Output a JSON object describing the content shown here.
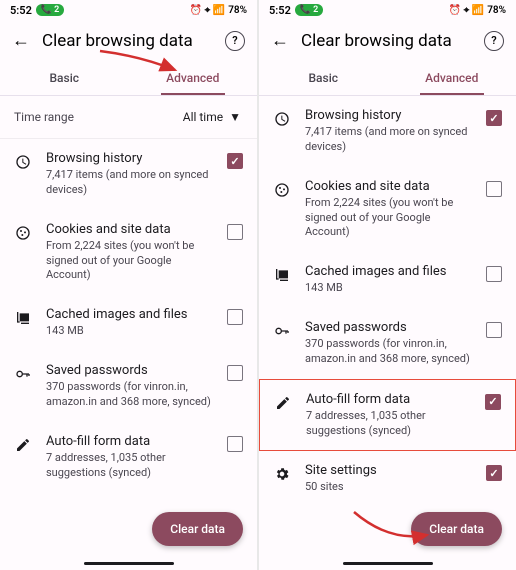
{
  "status": {
    "time": "5:52",
    "notif_count": "2",
    "battery": "78%",
    "icons": "⏰ ⌖ 📶"
  },
  "header": {
    "title": "Clear browsing data"
  },
  "tabs": {
    "basic": "Basic",
    "advanced": "Advanced"
  },
  "timerange": {
    "label": "Time range",
    "value": "All time"
  },
  "items": {
    "history": {
      "title": "Browsing history",
      "sub": "7,417 items (and more on synced devices)"
    },
    "cookies": {
      "title": "Cookies and site data",
      "sub": "From 2,224 sites (you won't be signed out of your Google Account)"
    },
    "cache": {
      "title": "Cached images and files",
      "sub": "143 MB"
    },
    "passwords": {
      "title": "Saved passwords",
      "sub": "370 passwords (for vinron.in, amazon.in and 368 more, synced)"
    },
    "autofill": {
      "title": "Auto-fill form data",
      "sub": "7 addresses, 1,035 other suggestions (synced)"
    },
    "site": {
      "title": "Site settings",
      "sub": "50 sites"
    }
  },
  "button": {
    "clear": "Clear data"
  }
}
